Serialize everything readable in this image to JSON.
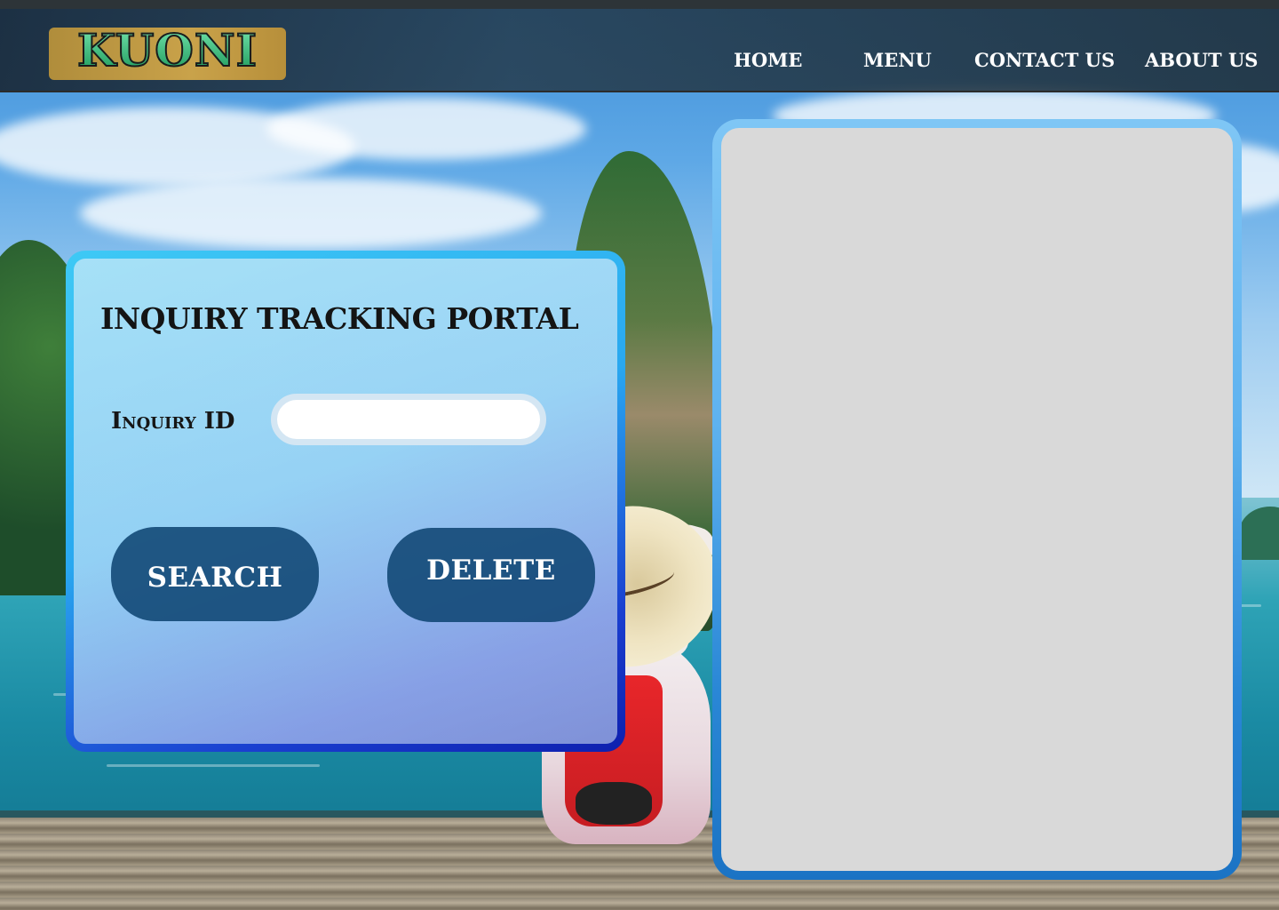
{
  "header": {
    "logo_text": "KUONI",
    "nav": [
      {
        "label": "HOME"
      },
      {
        "label": "MENU"
      },
      {
        "label": "CONTACT US"
      },
      {
        "label": "ABOUT  US"
      }
    ]
  },
  "form": {
    "title": "INQUIRY TRACKING PORTAL",
    "inquiry_label": "Inquiry ID",
    "inquiry_value": "",
    "search_label": "SEARCH",
    "delete_label": "DELETE"
  },
  "colors": {
    "header_bg": "#233746",
    "logo_bg": "#c9a24a",
    "logo_text": "#2aa86a",
    "panel_border": "#29a8f0",
    "button_bg": "#0f4673",
    "result_bg": "#d9d9d9",
    "result_border": "#5eb2ef"
  }
}
